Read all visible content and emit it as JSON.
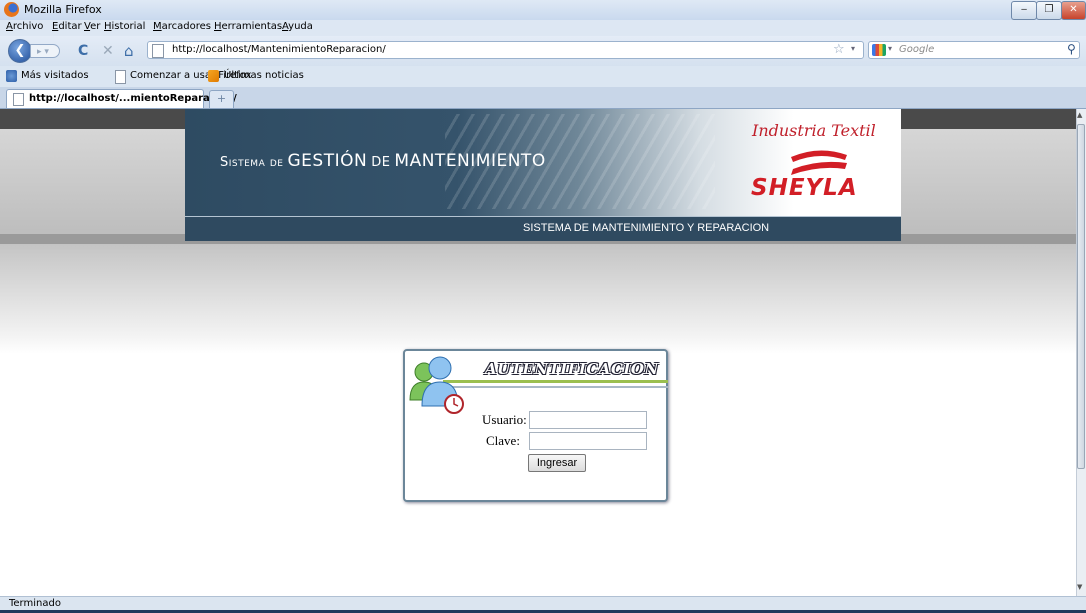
{
  "window": {
    "title": "Mozilla Firefox",
    "min_label": "‒",
    "max_label": "❐",
    "close_label": "✕"
  },
  "menu": [
    "Archivo",
    "Editar",
    "Ver",
    "Historial",
    "Marcadores",
    "Herramientas",
    "Ayuda"
  ],
  "nav": {
    "url": "http://localhost/MantenimientoReparacion/",
    "search_placeholder": "Google",
    "back_icon": "back-arrow-icon",
    "reload_icon": "reload-icon",
    "stop_icon": "stop-icon",
    "home_icon": "home-icon"
  },
  "bookmarks": [
    "Más visitados",
    "Comenzar a usar Firefox",
    "Últimas noticias"
  ],
  "tabs": {
    "active_label": "http://localhost/...mientoReparacion/",
    "new_tab_label": "+"
  },
  "page": {
    "banner_title_small1": "Sistema de",
    "banner_title_big1": "GESTIÓN",
    "banner_title_small2": "de",
    "banner_title_big2": "MANTENIMIENTO",
    "brand_tagline": "Industria Textil",
    "brand_name": "SHEYLA",
    "subtitle": "SISTEMA DE MANTENIMIENTO Y REPARACION",
    "accent_color": "#2f4a60",
    "brand_color": "#d21e26"
  },
  "login": {
    "title": "AUTENTIFICACION",
    "user_label": "Usuario:",
    "pass_label": "Clave:",
    "user_value": "",
    "pass_value": "",
    "submit_label": "Ingresar"
  },
  "status": {
    "text": "Terminado"
  }
}
